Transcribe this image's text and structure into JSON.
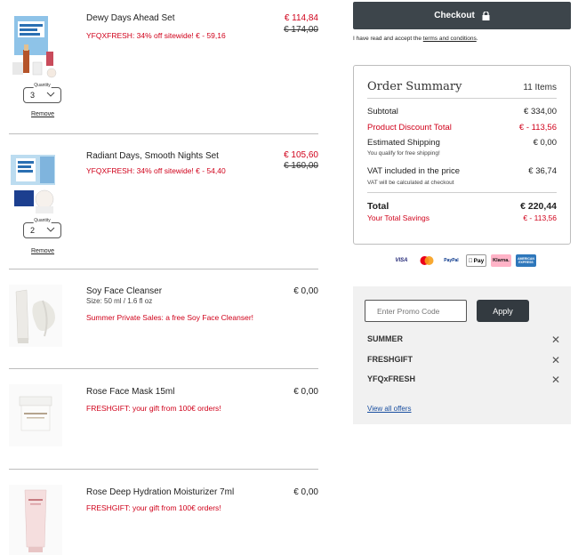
{
  "cart": {
    "items": [
      {
        "name": "Dewy Days Ahead Set",
        "promo": "YFQXFRESH: 34% off sitewide! € - 59,16",
        "price": "€ 114,84",
        "old_price": "€ 174,00",
        "quantity_label": "Quantity",
        "quantity": "3",
        "remove_label": "Remove"
      },
      {
        "name": "Radiant Days, Smooth Nights Set",
        "promo": "YFQXFRESH: 34% off sitewide! € - 54,40",
        "price": "€ 105,60",
        "old_price": "€ 160,00",
        "quantity_label": "Quantity",
        "quantity": "2",
        "remove_label": "Remove"
      },
      {
        "name": "Soy Face Cleanser",
        "size": "Size: 50 ml / 1.6 fl oz",
        "promo": "Summer Private Sales: a free Soy Face Cleanser!",
        "price": "€ 0,00"
      },
      {
        "name": "Rose Face Mask 15ml",
        "promo": "FRESHGIFT: your gift from 100€ orders!",
        "price": "€ 0,00"
      },
      {
        "name": "Rose Deep Hydration Moisturizer 7ml",
        "promo": "FRESHGIFT: your gift from 100€ orders!",
        "price": "€ 0,00"
      }
    ]
  },
  "checkout": {
    "label": "Checkout",
    "terms_prefix": "I have read and accept the ",
    "terms_link": "terms and conditions",
    "terms_suffix": "."
  },
  "summary": {
    "title": "Order Summary",
    "count": "11 Items",
    "subtotal_label": "Subtotal",
    "subtotal": "€ 334,00",
    "discount_label": "Product Discount Total",
    "discount": "€ - 113,56",
    "shipping_label": "Estimated Shipping",
    "shipping": "€ 0,00",
    "shipping_note": "You qualify for free shipping!",
    "vat_label": "VAT included in the price",
    "vat": "€ 36,74",
    "vat_note": "VAT will be calculated at checkout",
    "total_label": "Total",
    "total": "€ 220,44",
    "savings_label": "Your Total Savings",
    "savings": "€ - 113,56"
  },
  "payments": [
    "VISA",
    "Mastercard",
    "PayPal",
    "Pay",
    "Klarna.",
    "AMERICAN EXPRESS"
  ],
  "offers": {
    "placeholder": "Enter Promo Code",
    "apply_label": "Apply",
    "codes": [
      "SUMMER",
      "FRESHGIFT",
      "YFQxFRESH"
    ],
    "view_all": "View all offers"
  },
  "colors": {
    "accent_red": "#d0021b",
    "button_dark": "#3d454b",
    "link_blue": "#1a4fa0"
  }
}
